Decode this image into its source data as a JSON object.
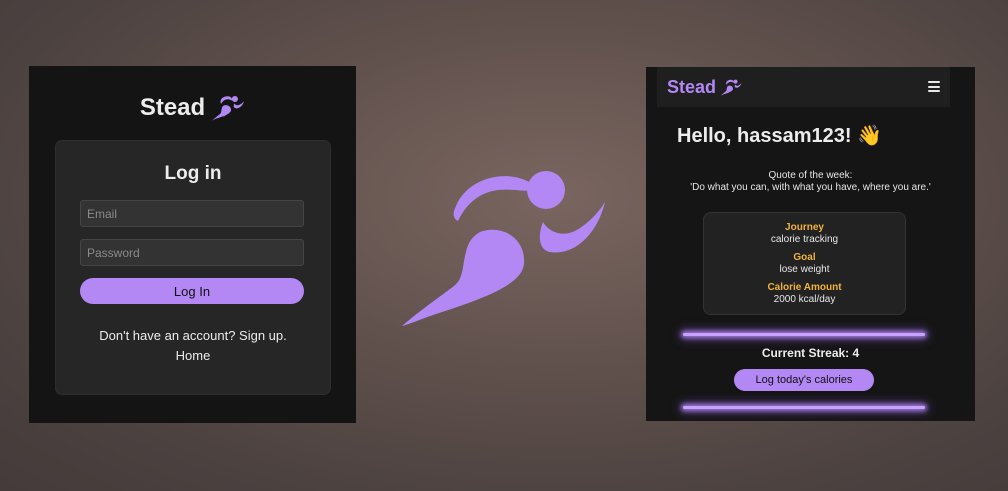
{
  "colors": {
    "accent": "#b388f5",
    "label_gold": "#f0b23c",
    "panel_bg": "#141414",
    "card_bg": "#262626"
  },
  "login_screen": {
    "brand": "Stead",
    "brand_icon": "runner-icon",
    "heading": "Log in",
    "email_placeholder": "Email",
    "password_placeholder": "Password",
    "login_button": "Log In",
    "signup_prompt": "Don't have an account? Sign up.",
    "home_link": "Home"
  },
  "center_logo": {
    "icon": "runner-icon"
  },
  "dashboard_screen": {
    "brand": "Stead",
    "brand_icon": "runner-icon",
    "menu_icon": "hamburger-menu-icon",
    "greeting": "Hello, hassam123! 👋",
    "quote_label": "Quote of the week:",
    "quote_text": "'Do what you can, with what you have, where you are.'",
    "profile": {
      "journey_label": "Journey",
      "journey_value": "calorie tracking",
      "goal_label": "Goal",
      "goal_value": "lose weight",
      "calorie_label": "Calorie Amount",
      "calorie_value": "2000 kcal/day"
    },
    "streak": "Current Streak: 4",
    "log_button": "Log today's calories"
  }
}
